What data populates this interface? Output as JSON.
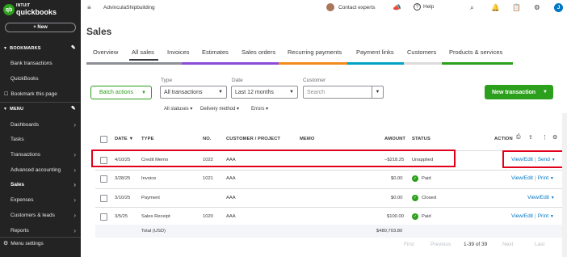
{
  "sidebar": {
    "logo_intuit": "INTUIT",
    "logo_name": "quickbooks",
    "new_label": "+ New",
    "bookmarks_label": "BOOKMARKS",
    "bookmark_items": [
      "Bank transactions",
      "QuickBooks"
    ],
    "bookmark_page_label": "Bookmark this page",
    "menu_label": "MENU",
    "menu_items": [
      "Dashboards",
      "Tasks",
      "Transactions",
      "Advanced accounting",
      "Sales",
      "Expenses",
      "Customers & leads",
      "Reports"
    ],
    "active_item": "Sales",
    "menu_settings_label": "Menu settings"
  },
  "topbar": {
    "company": "AdvinculaShipbuilding",
    "contact_experts": "Contact experts",
    "help": "Help",
    "user_initial": "J"
  },
  "page": {
    "title": "Sales"
  },
  "tabs": [
    {
      "label": "Overview",
      "color": "#8d9096"
    },
    {
      "label": "All sales",
      "color": "#8d9096"
    },
    {
      "label": "Invoices",
      "color": "#8c4bd6"
    },
    {
      "label": "Estimates",
      "color": "#8c4bd6"
    },
    {
      "label": "Sales orders",
      "color": "#8c4bd6"
    },
    {
      "label": "Recurring payments",
      "color": "#f28b1c"
    },
    {
      "label": "Payment links",
      "color": "#00a3c3"
    },
    {
      "label": "Customers",
      "color": "#dcdcdc"
    },
    {
      "label": "Products & services",
      "color": "#2ca01c"
    }
  ],
  "active_tab": "All sales",
  "filters": {
    "batch_actions": "Batch actions",
    "type_label": "Type",
    "type_value": "All transactions",
    "date_label": "Date",
    "date_value": "Last 12 months",
    "customer_label": "Customer",
    "search_placeholder": "Search",
    "all_statuses": "All statuses",
    "delivery_method": "Delivery method",
    "errors": "Errors",
    "new_transaction": "New transaction"
  },
  "table": {
    "headers": {
      "date": "DATE ▼",
      "type": "TYPE",
      "no": "NO.",
      "customer": "CUSTOMER / PROJECT",
      "memo": "MEMO",
      "amount": "AMOUNT",
      "status": "STATUS",
      "action": "ACTION"
    },
    "rows": [
      {
        "date": "4/10/25",
        "type": "Credit Memo",
        "no": "1022",
        "customer": "AAA",
        "amount": "−$218.25",
        "status": "Unapplied",
        "status_icon": false,
        "action1": "View/Edit",
        "action2": "Send"
      },
      {
        "date": "3/28/25",
        "type": "Invoice",
        "no": "1021",
        "customer": "AAA",
        "amount": "$0.00",
        "status": "Paid",
        "status_icon": true,
        "action1": "View/Edit",
        "action2": "Print"
      },
      {
        "date": "3/10/25",
        "type": "Payment",
        "no": "",
        "customer": "AAA",
        "amount": "$0.00",
        "status": "Closed",
        "status_icon": true,
        "action1": "View/Edit",
        "action2": ""
      },
      {
        "date": "3/5/25",
        "type": "Sales Receipt",
        "no": "1020",
        "customer": "AAA",
        "amount": "$100.00",
        "status": "Paid",
        "status_icon": true,
        "action1": "View/Edit",
        "action2": "Print"
      }
    ],
    "total_label": "Total (USD)",
    "total_amount": "$480,703.80"
  },
  "pager": {
    "first": "First",
    "previous": "Previous",
    "range": "1-39 of 39",
    "next": "Next",
    "last": "Last"
  }
}
